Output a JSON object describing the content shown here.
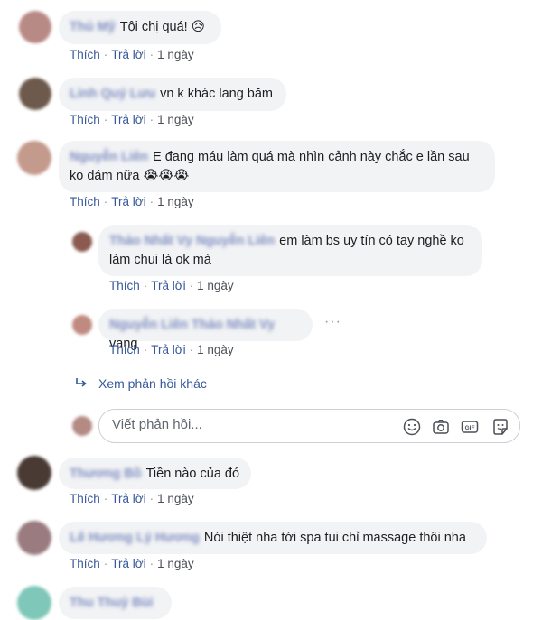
{
  "actions": {
    "like": "Thích",
    "reply": "Trả lời",
    "separator": "·"
  },
  "comments": [
    {
      "author": "Thủ Mỹ",
      "text": "Tội chị quá! 😥",
      "time": "1 ngày",
      "avatar_color": "#b88a86"
    },
    {
      "author": "Linh Quý Lưu",
      "text": "vn k khác lang băm",
      "time": "1 ngày",
      "avatar_color": "#6e5a4c"
    },
    {
      "author": "Nguyễn Liên",
      "text": "E đang máu làm quá mà nhìn cảnh này chắc e lần sau ko dám nữa 😭😭😭",
      "time": "1 ngày",
      "avatar_color": "#c49a8c"
    }
  ],
  "replies": [
    {
      "author": "Thảo Nhất Vy Nguyễn Liên",
      "text": "em làm bs uy tín có tay nghề ko làm chui là ok mà",
      "time": "1 ngày",
      "avatar_color": "#8a5a50"
    },
    {
      "author": "Nguyễn Liên Thảo Nhất Vy",
      "text": "vang",
      "time": "1 ngày",
      "avatar_color": "#c08a80"
    }
  ],
  "more_replies": "Xem phản hồi khác",
  "reply_input": {
    "placeholder": "Viết phản hồi...",
    "avatar_color": "#b48a84"
  },
  "reply_icons": [
    "emoji-icon",
    "camera-icon",
    "gif-icon",
    "sticker-icon"
  ],
  "gif_label": "GIF",
  "more_options": "···",
  "comments_after": [
    {
      "author": "Thương Bồ",
      "text": "Tiền nào của đó",
      "time": "1 ngày",
      "avatar_color": "#4a3a34"
    },
    {
      "author": "Lê Hương Lý Hương",
      "text": "Nói thiệt nha tới spa tui chỉ massage thôi nha",
      "time": "1 ngày",
      "avatar_color": "#9a7c80"
    },
    {
      "author": "Thu Thuỷ Bùi",
      "avatar_color": "#7fc7b8"
    }
  ]
}
